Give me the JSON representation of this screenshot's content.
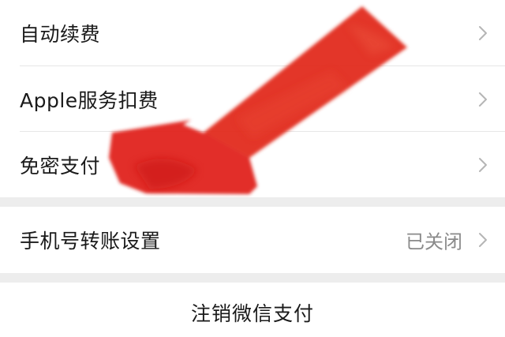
{
  "settings": {
    "rows": [
      {
        "label": "自动续费",
        "value": ""
      },
      {
        "label": "Apple服务扣费",
        "value": ""
      },
      {
        "label": "免密支付",
        "value": ""
      }
    ],
    "transfer": {
      "label": "手机号转账设置",
      "value": "已关闭"
    },
    "cancel_label": "注销微信支付"
  },
  "icons": {
    "chevron": "chevron-right-icon",
    "annotation": "red-arrow-annotation"
  },
  "colors": {
    "arrow_red": "#e0261c",
    "background": "#ededed",
    "text": "#1a1a1a",
    "secondary_text": "#8a8a8a"
  }
}
